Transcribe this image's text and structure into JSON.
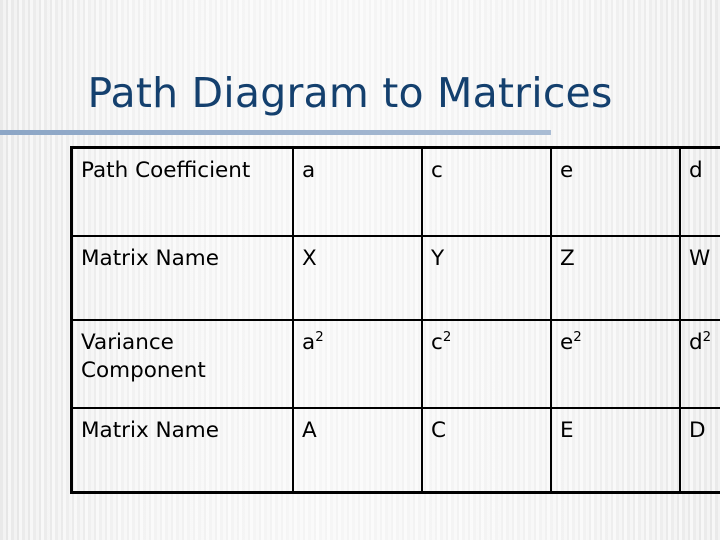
{
  "slide": {
    "title": "Path Diagram to Matrices",
    "title_color": "#14406e",
    "rule_color": "#93a9c7",
    "background_color": "#f0f0f0"
  },
  "table": {
    "rows": [
      {
        "label": "Path Coefficient",
        "cells": [
          {
            "base": "a",
            "sup": ""
          },
          {
            "base": "c",
            "sup": ""
          },
          {
            "base": "e",
            "sup": ""
          },
          {
            "base": "d",
            "sup": ""
          }
        ]
      },
      {
        "label": "Matrix Name",
        "cells": [
          {
            "base": "X",
            "sup": ""
          },
          {
            "base": "Y",
            "sup": ""
          },
          {
            "base": "Z",
            "sup": ""
          },
          {
            "base": "W",
            "sup": ""
          }
        ]
      },
      {
        "label": "Variance Component",
        "cells": [
          {
            "base": "a",
            "sup": "2"
          },
          {
            "base": "c",
            "sup": "2"
          },
          {
            "base": "e",
            "sup": "2"
          },
          {
            "base": "d",
            "sup": "2"
          }
        ]
      },
      {
        "label": "Matrix Name",
        "cells": [
          {
            "base": "A",
            "sup": ""
          },
          {
            "base": "C",
            "sup": ""
          },
          {
            "base": "E",
            "sup": ""
          },
          {
            "base": "D",
            "sup": ""
          }
        ]
      }
    ]
  }
}
